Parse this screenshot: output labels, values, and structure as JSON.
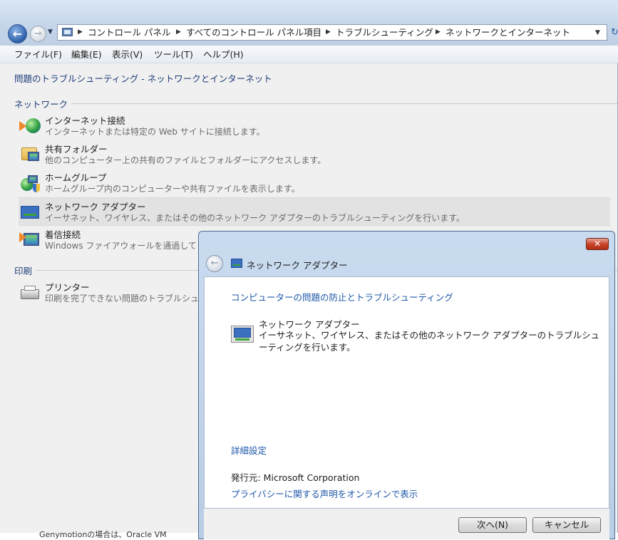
{
  "explorer": {
    "address": {
      "crumbs": [
        "コントロール パネル",
        "すべてのコントロール パネル項目",
        "トラブルシューティング",
        "ネットワークとインターネット"
      ]
    },
    "menu": [
      "ファイル(F)",
      "編集(E)",
      "表示(V)",
      "ツール(T)",
      "ヘルプ(H)"
    ],
    "page_title": "問題のトラブルシューティング - ネットワークとインターネット",
    "groups": {
      "network": {
        "title": "ネットワーク",
        "items": [
          {
            "name": "インターネット接続",
            "desc": "インターネットまたは特定の Web サイトに接続します。"
          },
          {
            "name": "共有フォルダー",
            "desc": "他のコンピューター上の共有のファイルとフォルダーにアクセスします。"
          },
          {
            "name": "ホームグループ",
            "desc": "ホームグループ内のコンピューターや共有ファイルを表示します。"
          },
          {
            "name": "ネットワーク アダプター",
            "desc": "イーサネット、ワイヤレス、またはその他のネットワーク アダプターのトラブルシューティングを行います。"
          },
          {
            "name": "着信接続",
            "desc": "Windows ファイアウォールを通過して"
          }
        ]
      },
      "print": {
        "title": "印刷",
        "items": [
          {
            "name": "プリンター",
            "desc": "印刷を完了できない問題のトラブルシュ"
          }
        ]
      }
    }
  },
  "dialog": {
    "title": "ネットワーク アダプター",
    "heading": "コンピューターの問題の防止とトラブルシューティング",
    "item_name": "ネットワーク アダプター",
    "item_desc": "イーサネット、ワイヤレス、またはその他のネットワーク アダプターのトラブルシューティングを行います。",
    "advanced": "詳細設定",
    "publisher": "発行元:  Microsoft Corporation",
    "privacy": "プライバシーに関する声明をオンラインで表示",
    "next_label": "次へ(N)",
    "cancel_label": "キャンセル"
  },
  "background_text": "Genymotionの場合は、Oracle VM",
  "colors": {
    "link": "#1e57a8",
    "group_header": "#1e3c78",
    "selected_row": "#e2e2e2"
  }
}
